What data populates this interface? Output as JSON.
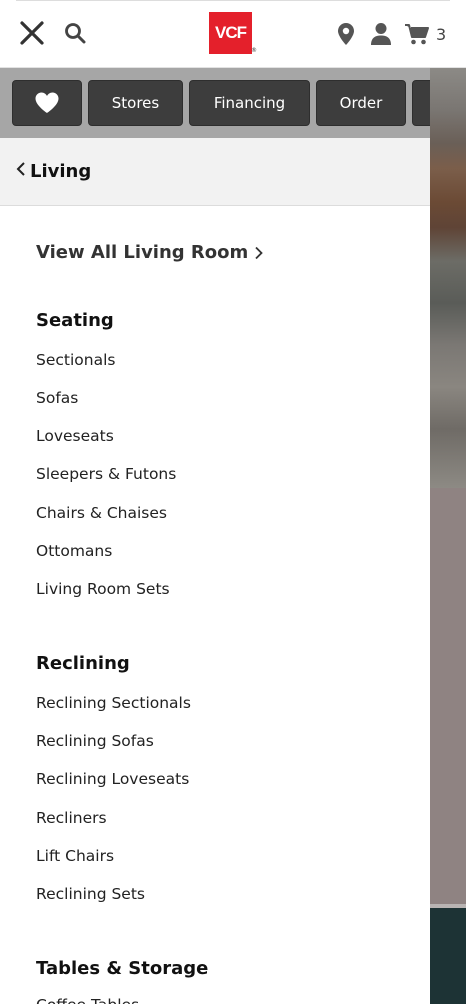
{
  "header": {
    "logo_text": "VCF",
    "logo_mark": "®",
    "cart_count": "3",
    "icons": [
      "close-icon",
      "search-icon",
      "location-pin-icon",
      "user-icon",
      "cart-icon"
    ]
  },
  "quick_links": {
    "heart_icon": "heart-icon",
    "stores": "Stores",
    "financing": "Financing",
    "order": "Order"
  },
  "drawer": {
    "back_label": "Living",
    "view_all": "View All Living Room",
    "sections": [
      {
        "title": "Seating",
        "links": [
          "Sectionals",
          "Sofas",
          "Loveseats",
          "Sleepers & Futons",
          "Chairs & Chaises",
          "Ottomans",
          "Living Room Sets"
        ]
      },
      {
        "title": "Reclining",
        "links": [
          "Reclining Sectionals",
          "Reclining Sofas",
          "Reclining Loveseats",
          "Recliners",
          "Lift Chairs",
          "Reclining Sets"
        ]
      },
      {
        "title": "Tables & Storage",
        "links": [
          "Coffee Tables"
        ]
      }
    ]
  },
  "colors": {
    "brand_red": "#e4202b",
    "pill_bg": "#3d3d3d",
    "row_bg": "#a6a6a6"
  }
}
